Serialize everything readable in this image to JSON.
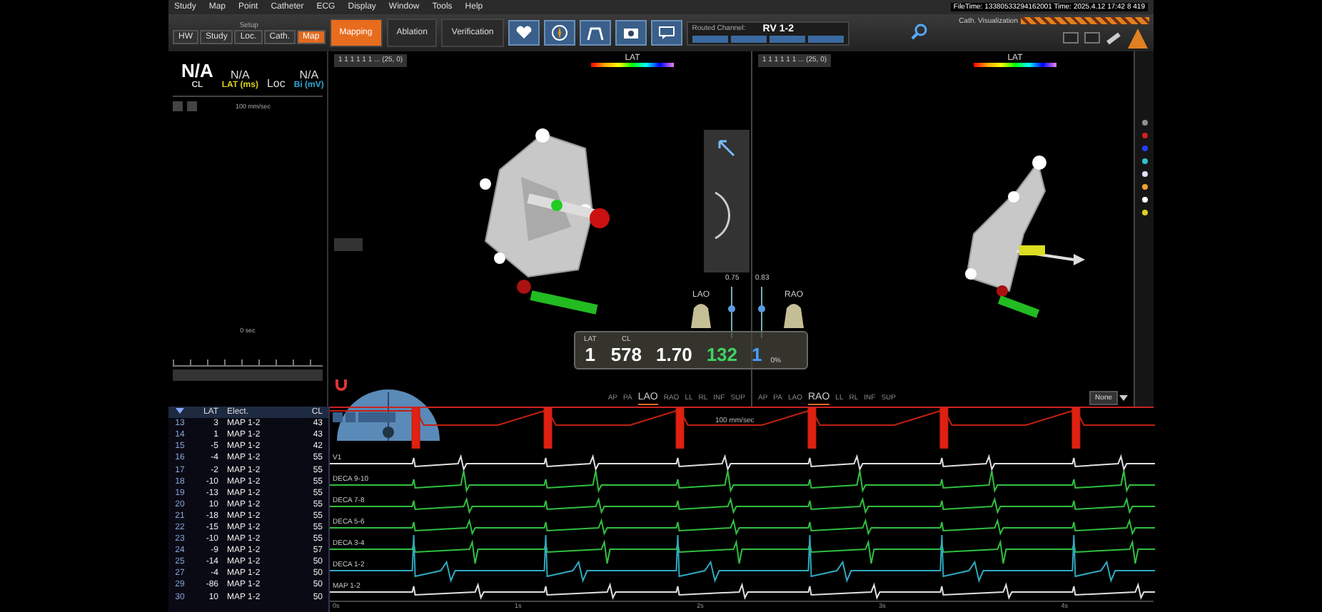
{
  "menu": [
    "Study",
    "Map",
    "Point",
    "Catheter",
    "ECG",
    "Display",
    "Window",
    "Tools",
    "Help"
  ],
  "status": {
    "file_time": "FileTime: 13380533294162001 Time: 2025.4.12 17:42 8 419",
    "visualization": "Cath. Visualization"
  },
  "setup": {
    "label": "Setup",
    "buttons": [
      {
        "label": "HW",
        "selected": false
      },
      {
        "label": "Study",
        "selected": false
      },
      {
        "label": "Loc.",
        "selected": false
      },
      {
        "label": "Cath.",
        "selected": false
      },
      {
        "label": "Map",
        "selected": true
      }
    ]
  },
  "modes": [
    {
      "label": "Mapping",
      "selected": true
    },
    {
      "label": "Ablation",
      "selected": false
    },
    {
      "label": "Verification",
      "selected": false
    }
  ],
  "routed_channel": {
    "label": "Routed Channel:",
    "value": "RV 1-2"
  },
  "summary": [
    {
      "value": "N/A",
      "label": "CL",
      "color": "#d0d0d0"
    },
    {
      "value": "N/A",
      "label": "LAT (ms)",
      "color": "#d8d020"
    },
    {
      "value": "Loc"
    },
    {
      "value": "N/A",
      "label": "Bi (mV)",
      "color": "#30a8d8"
    }
  ],
  "left_panel": {
    "speed": "100 mm/sec",
    "time": "0 sec"
  },
  "views": [
    {
      "selector": "1 1 1 1 1 1 ... (25, 0)",
      "legend": "LAT",
      "orientation": "LAO",
      "opacity": "0.75",
      "level": 0.55,
      "buttons": [
        {
          "label": "AP",
          "selected": false
        },
        {
          "label": "PA",
          "selected": false
        },
        {
          "label": "LAO",
          "selected": true
        },
        {
          "label": "RAO",
          "selected": false
        },
        {
          "label": "LL",
          "selected": false
        },
        {
          "label": "RL",
          "selected": false
        },
        {
          "label": "INF",
          "selected": false
        },
        {
          "label": "SUP",
          "selected": false
        }
      ]
    },
    {
      "selector": "1 1 1 1 1 1 ... (25, 0)",
      "legend": "LAT",
      "orientation": "RAO",
      "opacity": "0.83",
      "level": 0.55,
      "buttons": [
        {
          "label": "AP",
          "selected": false
        },
        {
          "label": "PA",
          "selected": false
        },
        {
          "label": "LAO",
          "selected": false
        },
        {
          "label": "RAO",
          "selected": true
        },
        {
          "label": "LL",
          "selected": false
        },
        {
          "label": "RL",
          "selected": false
        },
        {
          "label": "INF",
          "selected": false
        },
        {
          "label": "SUP",
          "selected": false
        }
      ]
    }
  ],
  "readout": {
    "fields": [
      {
        "label": "LAT",
        "value": "1",
        "color": "#ffffff"
      },
      {
        "label": "CL",
        "value": "578",
        "color": "#ffffff"
      },
      {
        "value": "1.70",
        "color": "#ffffff"
      },
      {
        "value": "132",
        "color": "#40d060"
      },
      {
        "value": "1",
        "color": "#4a9cff"
      }
    ],
    "scale": "0%"
  },
  "display_mode": "None",
  "palette": [
    {
      "color": "#909090"
    },
    {
      "color": "#d02020"
    },
    {
      "color": "#2040ff"
    },
    {
      "color": "#30c0d0"
    },
    {
      "color": "#e0e0ff"
    },
    {
      "color": "#f0a030"
    },
    {
      "color": "#ffffff"
    },
    {
      "color": "#e0d020"
    }
  ],
  "table": {
    "columns": [
      "LAT",
      "Elect.",
      "CL"
    ],
    "rows": [
      {
        "index": "13",
        "lat": "3",
        "electrode": "MAP 1-2",
        "cl": "43"
      },
      {
        "index": "14",
        "lat": "1",
        "electrode": "MAP 1-2",
        "cl": "43"
      },
      {
        "index": "15",
        "lat": "-5",
        "electrode": "MAP 1-2",
        "cl": "42"
      },
      {
        "index": "16",
        "lat": "-4",
        "electrode": "MAP 1-2",
        "cl": "55"
      },
      {
        "index": "17",
        "lat": "-2",
        "electrode": "MAP 1-2",
        "cl": "55"
      },
      {
        "index": "18",
        "lat": "-10",
        "electrode": "MAP 1-2",
        "cl": "55"
      },
      {
        "index": "19",
        "lat": "-13",
        "electrode": "MAP 1-2",
        "cl": "55"
      },
      {
        "index": "20",
        "lat": "10",
        "electrode": "MAP 1-2",
        "cl": "55"
      },
      {
        "index": "21",
        "lat": "-18",
        "electrode": "MAP 1-2",
        "cl": "55"
      },
      {
        "index": "22",
        "lat": "-15",
        "electrode": "MAP 1-2",
        "cl": "55"
      },
      {
        "index": "23",
        "lat": "-10",
        "electrode": "MAP 1-2",
        "cl": "55"
      },
      {
        "index": "24",
        "lat": "-9",
        "electrode": "MAP 1-2",
        "cl": "57"
      },
      {
        "index": "25",
        "lat": "-14",
        "electrode": "MAP 1-2",
        "cl": "50"
      },
      {
        "index": "27",
        "lat": "-4",
        "electrode": "MAP 1-2",
        "cl": "50"
      },
      {
        "index": "29",
        "lat": "-86",
        "electrode": "MAP 1-2",
        "cl": "50"
      },
      {
        "index": "30",
        "lat": "10",
        "electrode": "MAP 1-2",
        "cl": "50"
      }
    ]
  },
  "traces": {
    "speed": "100 mm/sec",
    "channels": [
      {
        "name": "V1",
        "color": "#e0e0e0"
      },
      {
        "name": "DECA 9-10",
        "color": "#30c040"
      },
      {
        "name": "DECA 7-8",
        "color": "#30c040"
      },
      {
        "name": "DECA 5-6",
        "color": "#30c040"
      },
      {
        "name": "DECA 3-4",
        "color": "#30c040"
      },
      {
        "name": "DECA 1-2",
        "color": "#30a8c0"
      },
      {
        "name": "MAP 1-2",
        "color": "#e0e0e0"
      }
    ],
    "time_labels": [
      "0s",
      "1s",
      "2s",
      "3s",
      "4s"
    ]
  }
}
